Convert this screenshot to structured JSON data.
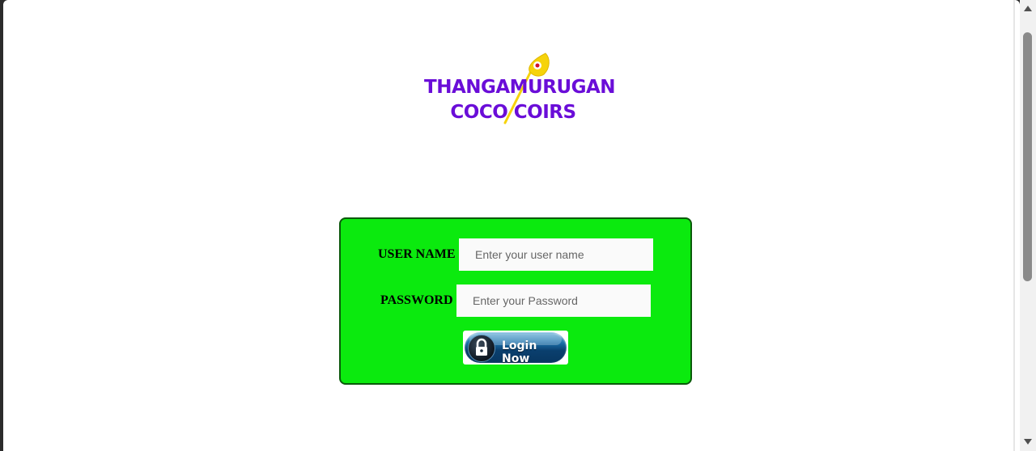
{
  "logo": {
    "line1": "THANGAMURUGAN",
    "line2": "COCO COIRS",
    "accent": "#6a0dd8",
    "spear_color": "#f6d30b"
  },
  "login_form": {
    "username_label": "USER NAME",
    "username_placeholder": "Enter your user name",
    "password_label": "PASSWORD",
    "password_placeholder": "Enter your Password",
    "button_label": "Login Now",
    "panel_color": "#0bea0e"
  }
}
